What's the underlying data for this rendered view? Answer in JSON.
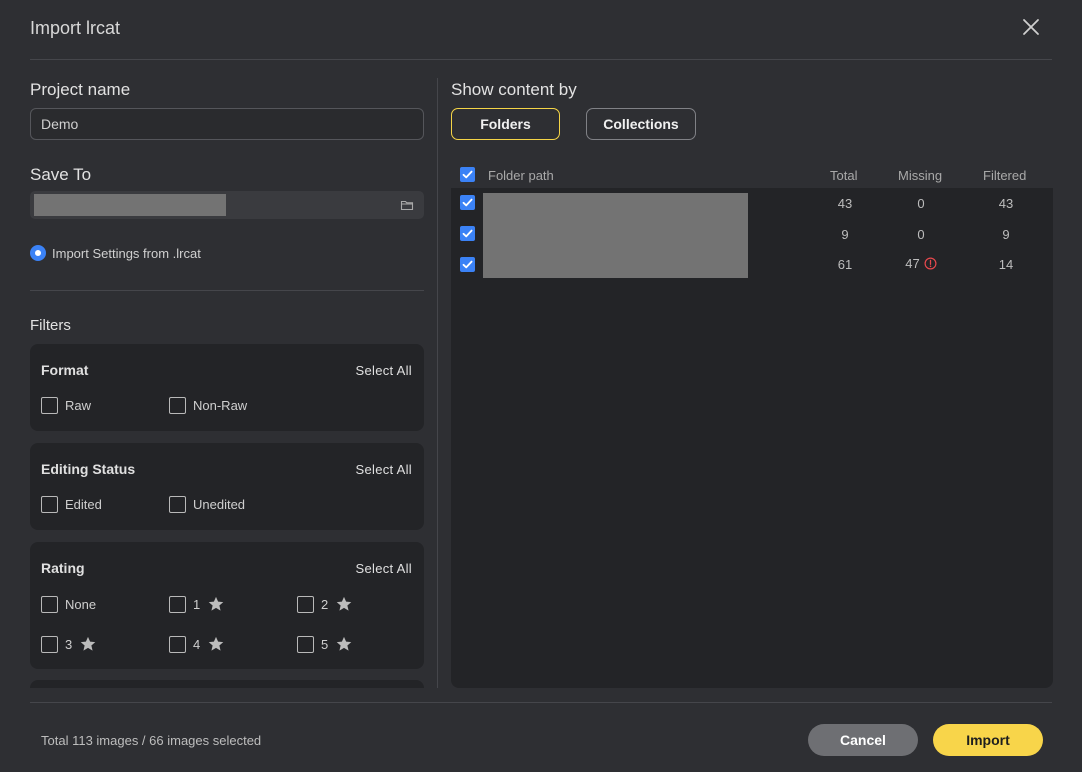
{
  "dialog": {
    "title": "Import lrcat"
  },
  "project": {
    "label": "Project name",
    "value": "Demo"
  },
  "save_to": {
    "label": "Save To"
  },
  "import_settings": {
    "label": "Import Settings from .lrcat"
  },
  "filters": {
    "label": "Filters",
    "select_all": "Select All",
    "format": {
      "title": "Format",
      "options": [
        "Raw",
        "Non-Raw"
      ]
    },
    "editing_status": {
      "title": "Editing Status",
      "options": [
        "Edited",
        "Unedited"
      ]
    },
    "rating": {
      "title": "Rating",
      "options": [
        "None",
        "1",
        "2",
        "3",
        "4",
        "5"
      ]
    }
  },
  "content": {
    "label": "Show content by",
    "tabs": [
      "Folders",
      "Collections"
    ],
    "active_tab": "Folders"
  },
  "table": {
    "headers": {
      "path": "Folder path",
      "total": "Total",
      "missing": "Missing",
      "filtered": "Filtered"
    },
    "rows": [
      {
        "total": "43",
        "missing": "0",
        "filtered": "43",
        "warning": false
      },
      {
        "total": "9",
        "missing": "0",
        "filtered": "9",
        "warning": false
      },
      {
        "total": "61",
        "missing": "47",
        "filtered": "14",
        "warning": true
      }
    ]
  },
  "footer": {
    "status": "Total 113 images / 66 images selected",
    "cancel": "Cancel",
    "import": "Import"
  },
  "colors": {
    "accent_yellow": "#f8d54a",
    "checkbox_blue": "#3b82f6",
    "warning_red": "#e5484d"
  }
}
